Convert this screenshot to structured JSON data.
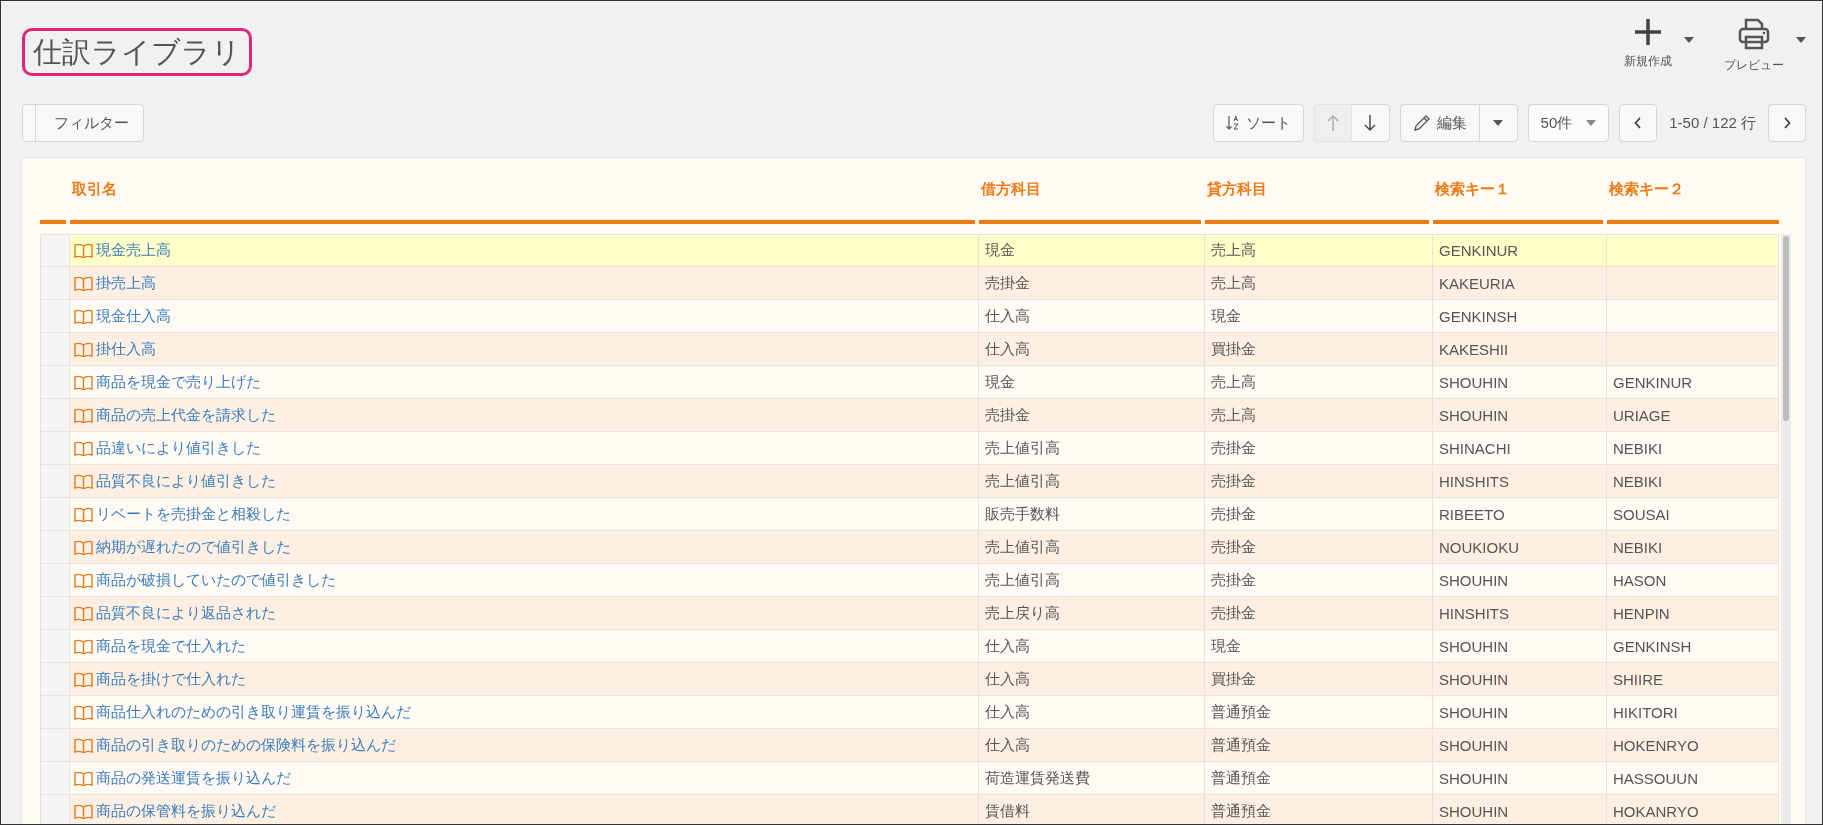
{
  "title": "仕訳ライブラリ",
  "header_actions": [
    {
      "kind": "new",
      "label": "新規作成"
    },
    {
      "kind": "preview",
      "label": "プレビュー"
    }
  ],
  "toolbar": {
    "filter": "フィルター",
    "sort": "ソート",
    "move_up": {
      "disabled": true
    },
    "move_down": {
      "disabled": false
    },
    "edit": "編集",
    "page_size": "50件",
    "range": "1-50 / 122 行"
  },
  "table": {
    "columns": [
      "取引名",
      "借方科目",
      "貸方科目",
      "検索キー１",
      "検索キー２"
    ],
    "rows": [
      {
        "name": "現金売上高",
        "debit": "現金",
        "credit": "売上高",
        "key1": "GENKINUR",
        "selected": true
      },
      {
        "name": "掛売上高",
        "debit": "売掛金",
        "credit": "売上高",
        "key1": "KAKEURIA",
        "selected": false
      },
      {
        "name": "現金仕入高",
        "debit": "仕入高",
        "credit": "現金",
        "key1": "GENKINSH",
        "selected": false
      },
      {
        "name": "掛仕入高",
        "debit": "仕入高",
        "credit": "買掛金",
        "key1": "KAKESHII",
        "selected": false
      },
      {
        "name": "商品を現金で売り上げた",
        "debit": "現金",
        "credit": "売上高",
        "key1": "SHOUHIN",
        "key2": "GENKINUR",
        "selected": false
      },
      {
        "name": "商品の売上代金を請求した",
        "debit": "売掛金",
        "credit": "売上高",
        "key1": "SHOUHIN",
        "key2": "URIAGE",
        "selected": false
      },
      {
        "name": "品違いにより値引きした",
        "debit": "売上値引高",
        "credit": "売掛金",
        "key1": "SHINACHI",
        "key2": "NEBIKI",
        "selected": false
      },
      {
        "name": "品質不良により値引きした",
        "debit": "売上値引高",
        "credit": "売掛金",
        "key1": "HINSHITS",
        "key2": "NEBIKI",
        "selected": false
      },
      {
        "name": "リベートを売掛金と相殺した",
        "debit": "販売手数料",
        "credit": "売掛金",
        "key1": "RIBEETO",
        "key2": "SOUSAI",
        "selected": false
      },
      {
        "name": "納期が遅れたので値引きした",
        "debit": "売上値引高",
        "credit": "売掛金",
        "key1": "NOUKIOKU",
        "key2": "NEBIKI",
        "selected": false
      },
      {
        "name": "商品が破損していたので値引きした",
        "debit": "売上値引高",
        "credit": "売掛金",
        "key1": "SHOUHIN",
        "key2": "HASON",
        "selected": false
      },
      {
        "name": "品質不良により返品された",
        "debit": "売上戻り高",
        "credit": "売掛金",
        "key1": "HINSHITS",
        "key2": "HENPIN",
        "selected": false
      },
      {
        "name": "商品を現金で仕入れた",
        "debit": "仕入高",
        "credit": "現金",
        "key1": "SHOUHIN",
        "key2": "GENKINSH",
        "selected": false
      },
      {
        "name": "商品を掛けで仕入れた",
        "debit": "仕入高",
        "credit": "買掛金",
        "key1": "SHOUHIN",
        "key2": "SHIIRE",
        "selected": false
      },
      {
        "name": "商品仕入れのための引き取り運賃を振り込んだ",
        "debit": "仕入高",
        "credit": "普通預金",
        "key1": "SHOUHIN",
        "key2": "HIKITORI",
        "selected": false
      },
      {
        "name": "商品の引き取りのための保険料を振り込んだ",
        "debit": "仕入高",
        "credit": "普通預金",
        "key1": "SHOUHIN",
        "key2": "HOKENRYO",
        "selected": false
      },
      {
        "name": "商品の発送運賃を振り込んだ",
        "debit": "荷造運賃発送費",
        "credit": "普通預金",
        "key1": "SHOUHIN",
        "key2": "HASSOUUN",
        "selected": false
      },
      {
        "name": "商品の保管料を振り込んだ",
        "debit": "賃借料",
        "credit": "普通預金",
        "key1": "SHOUHIN",
        "key2": "HOKANRYO",
        "selected": false
      }
    ]
  }
}
